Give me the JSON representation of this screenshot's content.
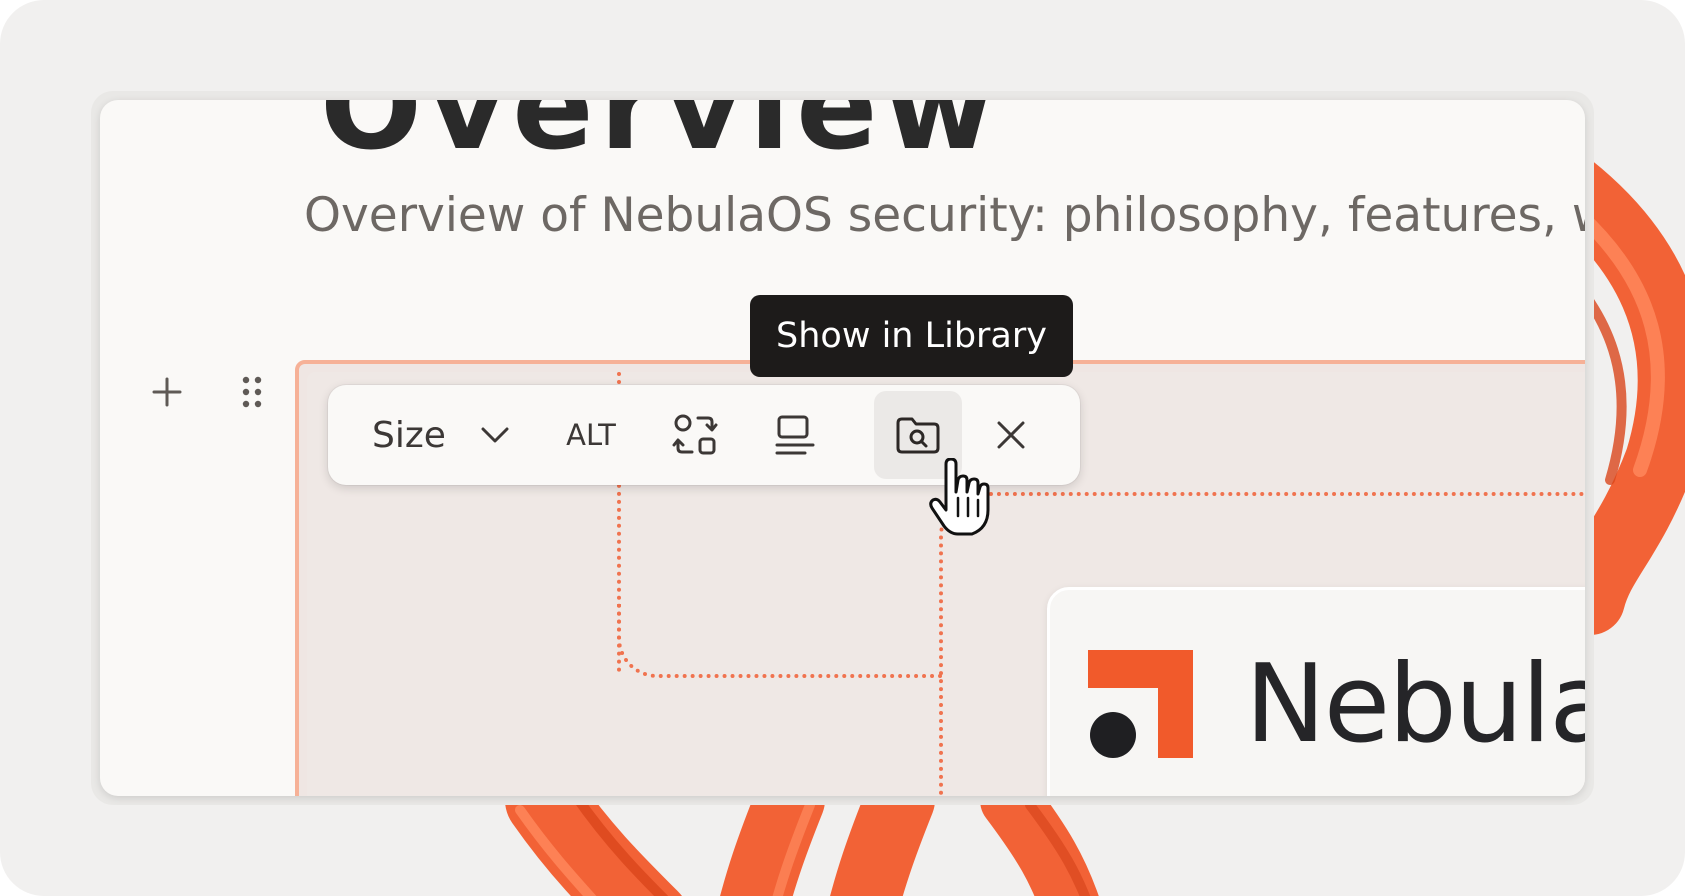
{
  "document": {
    "heading_partial": "Overview",
    "subtitle": "Overview of NebulaOS security: philosophy, features, wo"
  },
  "gutter": {
    "add_label": "+",
    "drag_handle_icon": "drag-handle-icon"
  },
  "image_toolbar": {
    "size_label": "Size",
    "alt_label": "ALT",
    "buttons": [
      "size-dropdown",
      "alt-text",
      "replace-image",
      "caption",
      "show-in-library",
      "close"
    ]
  },
  "tooltip": {
    "text": "Show in Library"
  },
  "image": {
    "logo_text": "Nebula"
  },
  "colors": {
    "accent": "#f15a2b",
    "selection_border": "#f6b197",
    "tooltip_bg": "#1d1b1a"
  }
}
